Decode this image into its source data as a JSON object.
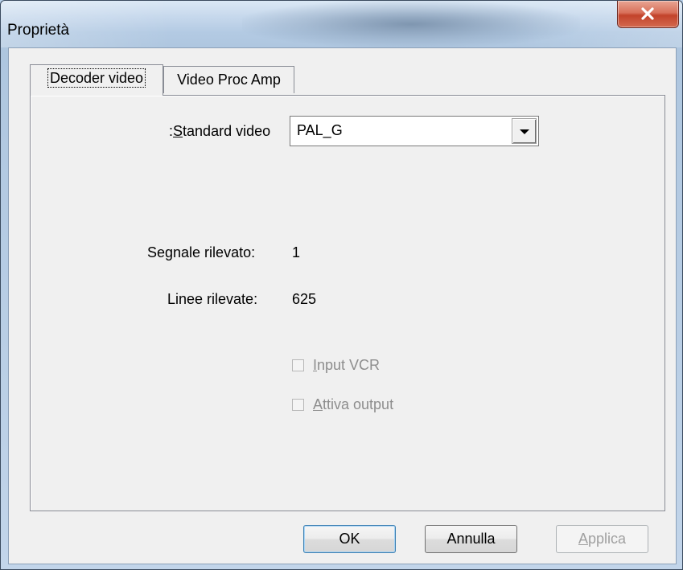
{
  "window": {
    "title": "Proprietà"
  },
  "tabs": [
    {
      "label": "Decoder video",
      "active": true
    },
    {
      "label": "Video Proc Amp",
      "active": false
    }
  ],
  "decoder": {
    "standard_video_label_prefix": ":",
    "standard_video_label_mnemonic": "S",
    "standard_video_label_rest": "tandard video",
    "standard_video_value": "PAL_G",
    "signal_label": "Segnale rilevato:",
    "signal_value": "1",
    "lines_label": "Linee rilevate:",
    "lines_value": "625",
    "input_vcr_mnemonic": "I",
    "input_vcr_rest": "nput VCR",
    "enable_output_mnemonic": "A",
    "enable_output_rest": "ttiva output"
  },
  "buttons": {
    "ok": "OK",
    "cancel": "Annulla",
    "apply_mnemonic": "A",
    "apply_rest": "pplica"
  },
  "icons": {
    "close": "close-icon",
    "dropdown": "chevron-down-icon"
  },
  "colors": {
    "close_button": "#c2432b",
    "disabled_text": "#8d8d8d",
    "dialog_bg": "#f0f0f0"
  }
}
